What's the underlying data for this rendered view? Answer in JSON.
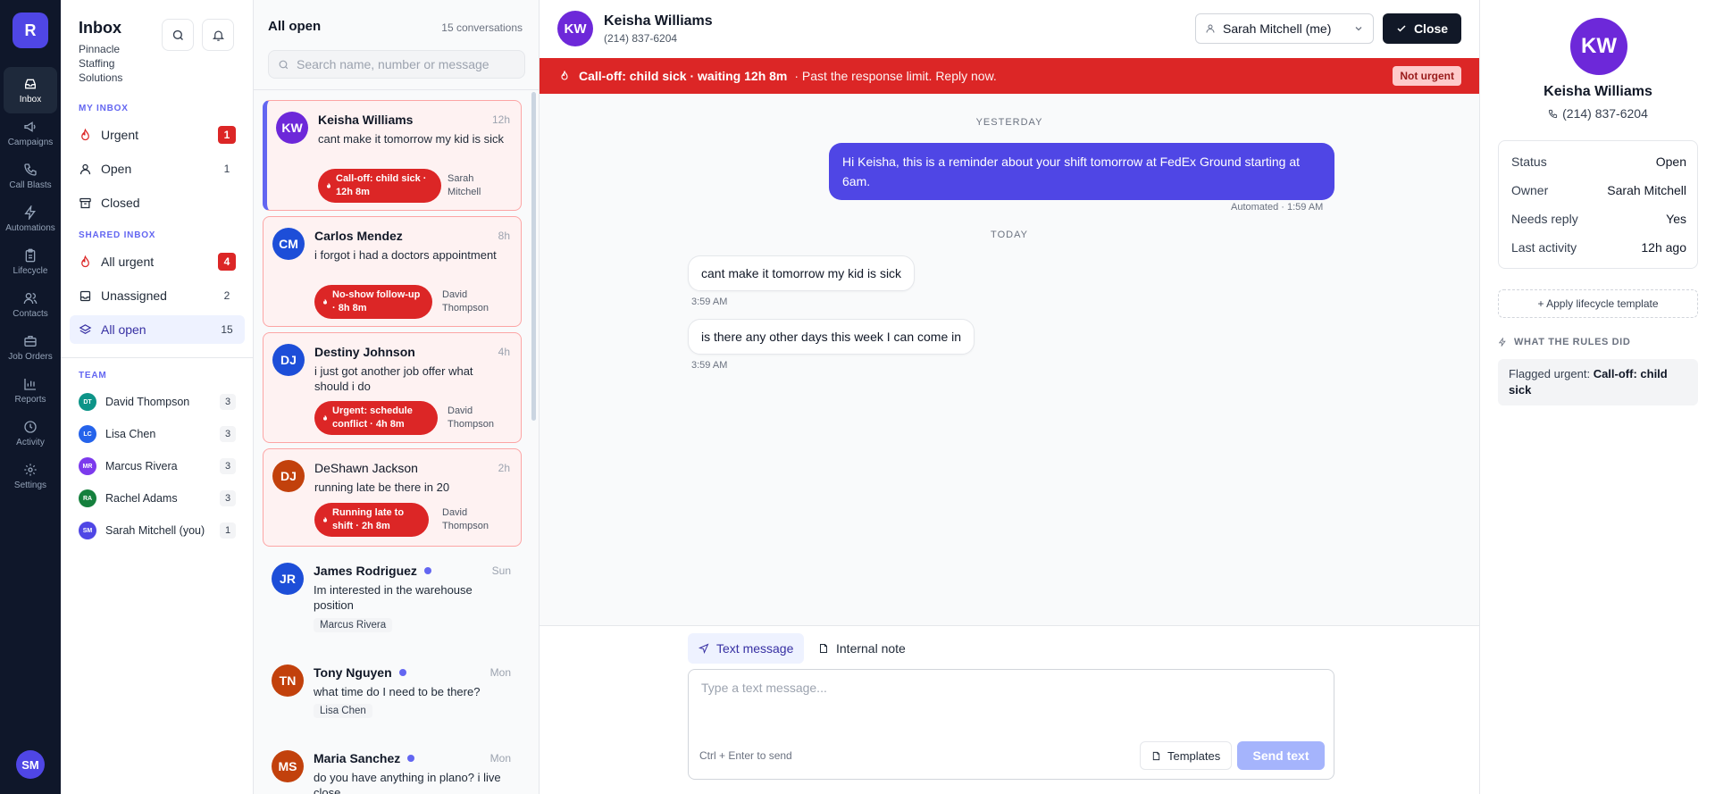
{
  "rail": {
    "logo": "R",
    "items": [
      {
        "label": "Inbox"
      },
      {
        "label": "Campaigns"
      },
      {
        "label": "Call Blasts"
      },
      {
        "label": "Automations"
      },
      {
        "label": "Lifecycle"
      },
      {
        "label": "Contacts"
      },
      {
        "label": "Job Orders"
      },
      {
        "label": "Reports"
      },
      {
        "label": "Activity"
      },
      {
        "label": "Settings"
      }
    ],
    "user_initials": "SM"
  },
  "nav": {
    "title": "Inbox",
    "org": "Pinnacle Staffing Solutions",
    "my_inbox_label": "MY INBOX",
    "my_inbox": [
      {
        "label": "Urgent",
        "count": "1"
      },
      {
        "label": "Open",
        "count": "1"
      },
      {
        "label": "Closed",
        "count": ""
      }
    ],
    "shared_inbox_label": "SHARED INBOX",
    "shared_inbox": [
      {
        "label": "All urgent",
        "count": "4"
      },
      {
        "label": "Unassigned",
        "count": "2"
      },
      {
        "label": "All open",
        "count": "15"
      }
    ],
    "team_label": "TEAM",
    "team": [
      {
        "initials": "DT",
        "name": "David Thompson",
        "count": "3",
        "color": "#0d9488"
      },
      {
        "initials": "LC",
        "name": "Lisa Chen",
        "count": "3",
        "color": "#2563eb"
      },
      {
        "initials": "MR",
        "name": "Marcus Rivera",
        "count": "3",
        "color": "#7c3aed"
      },
      {
        "initials": "RA",
        "name": "Rachel Adams",
        "count": "3",
        "color": "#15803d"
      },
      {
        "initials": "SM",
        "name": "Sarah Mitchell (you)",
        "count": "1",
        "color": "#4f46e5"
      }
    ]
  },
  "list": {
    "title": "All open",
    "count": "15 conversations",
    "search_placeholder": "Search name, number or message",
    "conversations": [
      {
        "initials": "KW",
        "name": "Keisha Williams",
        "time": "12h",
        "message": "cant make it tomorrow my kid is sick",
        "tag": "Call-off: child sick · 12h 8m",
        "owner": "Sarah Mitchell",
        "color": "#6d28d9"
      },
      {
        "initials": "CM",
        "name": "Carlos Mendez",
        "time": "8h",
        "message": "i forgot i had a doctors appointment",
        "tag": "No-show follow-up · 8h 8m",
        "owner": "David Thompson",
        "color": "#1d4ed8"
      },
      {
        "initials": "DJ",
        "name": "Destiny Johnson",
        "time": "4h",
        "message": "i just got another job offer what should i do",
        "tag": "Urgent: schedule conflict · 4h 8m",
        "owner": "David Thompson",
        "color": "#1d4ed8"
      },
      {
        "initials": "DJ",
        "name": "DeShawn Jackson",
        "time": "2h",
        "message": "running late be there in 20",
        "tag": "Running late to shift · 2h 8m",
        "owner": "David Thompson",
        "color": "#c2410c"
      },
      {
        "initials": "JR",
        "name": "James Rodriguez",
        "time": "Sun",
        "message": "Im interested in the warehouse position",
        "owner": "Marcus Rivera",
        "color": "#1d4ed8"
      },
      {
        "initials": "TN",
        "name": "Tony Nguyen",
        "time": "Mon",
        "message": "what time do I need to be there?",
        "owner": "Lisa Chen",
        "color": "#c2410c"
      },
      {
        "initials": "MS",
        "name": "Maria Sanchez",
        "time": "Mon",
        "message": "do you have anything in plano? i live close",
        "color": "#c2410c"
      }
    ]
  },
  "chat": {
    "contact": {
      "initials": "KW",
      "name": "Keisha Williams",
      "phone": "(214) 837-6204"
    },
    "assignee": "Sarah Mitchell (me)",
    "close_label": "Close",
    "alert": {
      "title": "Call-off: child sick · waiting 12h 8m",
      "sub": "· Past the response limit. Reply now.",
      "button": "Not urgent"
    },
    "day1": "YESTERDAY",
    "outgoing": "Hi Keisha, this is a reminder about your shift tomorrow at FedEx Ground starting at 6am.",
    "outgoing_meta": "Automated · 1:59 AM",
    "day2": "TODAY",
    "incoming": [
      {
        "text": "cant make it tomorrow my kid is sick",
        "time": "3:59 AM"
      },
      {
        "text": "is there any other days this week I can come in",
        "time": "3:59 AM"
      }
    ],
    "composer": {
      "tab_text": "Text message",
      "tab_note": "Internal note",
      "placeholder": "Type a text message...",
      "hint": "Ctrl + Enter to send",
      "templates": "Templates",
      "send": "Send text"
    }
  },
  "side": {
    "initials": "KW",
    "name": "Keisha Williams",
    "phone": "(214) 837-6204",
    "details": [
      {
        "key": "Status",
        "value": "Open"
      },
      {
        "key": "Owner",
        "value": "Sarah Mitchell"
      },
      {
        "key": "Needs reply",
        "value": "Yes"
      },
      {
        "key": "Last activity",
        "value": "12h ago"
      }
    ],
    "apply_template": "+ Apply lifecycle template",
    "rules_label": "WHAT THE RULES DID",
    "rule_prefix": "Flagged urgent: ",
    "rule_value": "Call-off: child sick"
  }
}
